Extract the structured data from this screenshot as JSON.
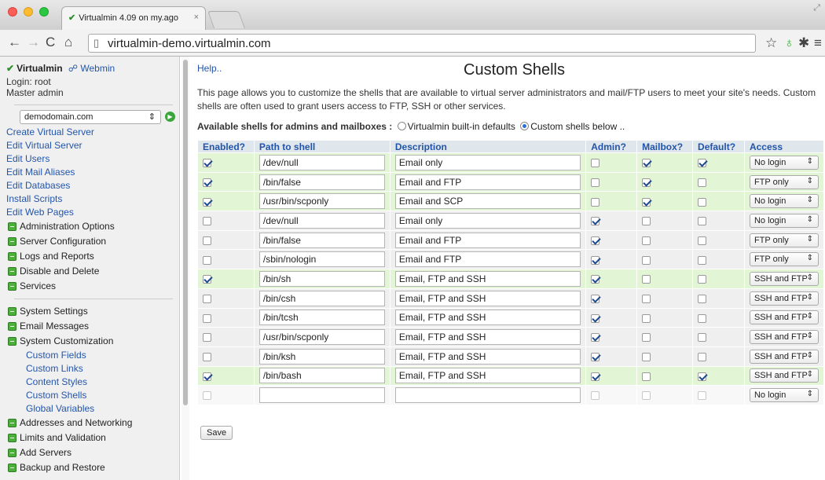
{
  "browser": {
    "tab_title": "Virtualmin 4.09 on my.ago",
    "tab_close": "×",
    "url": "virtualmin-demo.virtualmin.com"
  },
  "sidebar": {
    "brand": "Virtualmin",
    "webmin": "Webmin",
    "login": "Login: root",
    "role": "Master admin",
    "domain": "demodomain.com",
    "links": [
      "Create Virtual Server",
      "Edit Virtual Server",
      "Edit Users",
      "Edit Mail Aliases",
      "Edit Databases",
      "Install Scripts",
      "Edit Web Pages"
    ],
    "sections_a": [
      "Administration Options",
      "Server Configuration",
      "Logs and Reports",
      "Disable and Delete",
      "Services"
    ],
    "sections_b": [
      "System Settings",
      "Email Messages",
      "System Customization"
    ],
    "sublinks": [
      "Custom Fields",
      "Custom Links",
      "Content Styles",
      "Custom Shells",
      "Global Variables"
    ],
    "sections_c": [
      "Addresses and Networking",
      "Limits and Validation",
      "Add Servers",
      "Backup and Restore"
    ]
  },
  "main": {
    "help": "Help..",
    "title": "Custom Shells",
    "intro": "This page allows you to customize the shells that are available to virtual server administrators and mail/FTP users to meet your site's needs. Custom shells are often used to grant users access to FTP, SSH or other services.",
    "available_label": "Available shells for admins and mailboxes :",
    "option_builtin": "Virtualmin built-in defaults",
    "option_custom": "Custom shells below ..",
    "save": "Save"
  },
  "table": {
    "headers": [
      "Enabled?",
      "Path to shell",
      "Description",
      "Admin?",
      "Mailbox?",
      "Default?",
      "Access"
    ],
    "rows": [
      {
        "enabled": true,
        "path": "/dev/null",
        "desc": "Email only",
        "admin": false,
        "mailbox": true,
        "default": true,
        "access": "No login"
      },
      {
        "enabled": true,
        "path": "/bin/false",
        "desc": "Email and FTP",
        "admin": false,
        "mailbox": true,
        "default": false,
        "access": "FTP only"
      },
      {
        "enabled": true,
        "path": "/usr/bin/scponly",
        "desc": "Email and SCP",
        "admin": false,
        "mailbox": true,
        "default": false,
        "access": "No login"
      },
      {
        "enabled": false,
        "path": "/dev/null",
        "desc": "Email only",
        "admin": true,
        "mailbox": false,
        "default": false,
        "access": "No login"
      },
      {
        "enabled": false,
        "path": "/bin/false",
        "desc": "Email and FTP",
        "admin": true,
        "mailbox": false,
        "default": false,
        "access": "FTP only"
      },
      {
        "enabled": false,
        "path": "/sbin/nologin",
        "desc": "Email and FTP",
        "admin": true,
        "mailbox": false,
        "default": false,
        "access": "FTP only"
      },
      {
        "enabled": true,
        "path": "/bin/sh",
        "desc": "Email, FTP and SSH",
        "admin": true,
        "mailbox": false,
        "default": false,
        "access": "SSH and FTP"
      },
      {
        "enabled": false,
        "path": "/bin/csh",
        "desc": "Email, FTP and SSH",
        "admin": true,
        "mailbox": false,
        "default": false,
        "access": "SSH and FTP"
      },
      {
        "enabled": false,
        "path": "/bin/tcsh",
        "desc": "Email, FTP and SSH",
        "admin": true,
        "mailbox": false,
        "default": false,
        "access": "SSH and FTP"
      },
      {
        "enabled": false,
        "path": "/usr/bin/scponly",
        "desc": "Email, FTP and SSH",
        "admin": true,
        "mailbox": false,
        "default": false,
        "access": "SSH and FTP"
      },
      {
        "enabled": false,
        "path": "/bin/ksh",
        "desc": "Email, FTP and SSH",
        "admin": true,
        "mailbox": false,
        "default": false,
        "access": "SSH and FTP"
      },
      {
        "enabled": true,
        "path": "/bin/bash",
        "desc": "Email, FTP and SSH",
        "admin": true,
        "mailbox": false,
        "default": true,
        "access": "SSH and FTP"
      },
      {
        "enabled": false,
        "path": "",
        "desc": "",
        "admin": false,
        "mailbox": false,
        "default": false,
        "access": "No login",
        "blank": true
      }
    ]
  },
  "colors": {
    "link": "#2255aa",
    "enabled_row": "#e2f6d6",
    "accent_green": "#4caf3a"
  }
}
